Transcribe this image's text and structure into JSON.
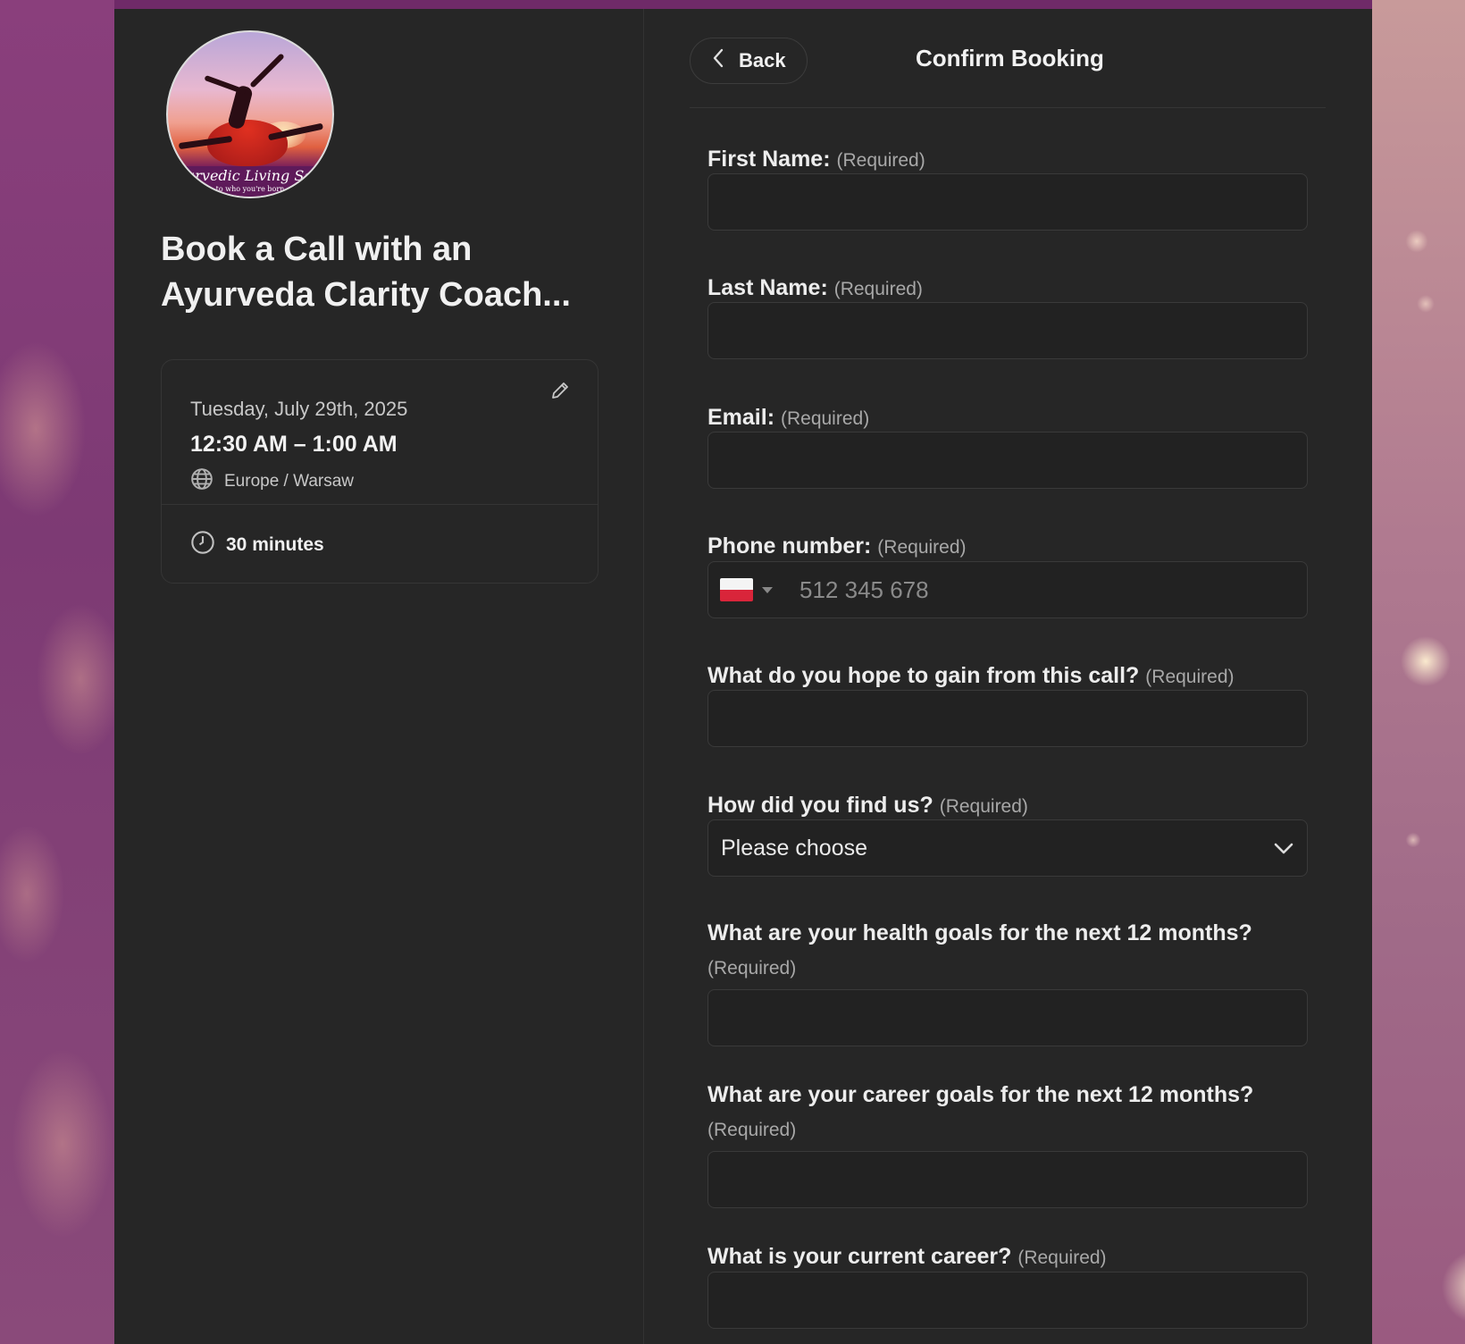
{
  "event": {
    "title": "Book a Call with an Ayurveda Clarity Coach...",
    "avatar_banner": "Ayurvedic Living School",
    "avatar_tagline": "to who you're born",
    "date": "Tuesday, July 29th, 2025",
    "time": "12:30 AM – 1:00 AM",
    "timezone": "Europe / Warsaw",
    "duration": "30 minutes"
  },
  "header": {
    "back_label": "Back",
    "title": "Confirm Booking"
  },
  "form": {
    "required_tag": "(Required)",
    "first_name_label": "First Name:",
    "first_name_value": "",
    "last_name_label": "Last Name:",
    "last_name_value": "",
    "email_label": "Email:",
    "email_value": "",
    "phone_label": "Phone number:",
    "phone_placeholder": "512 345 678",
    "phone_country": "PL",
    "gain_label": "What do you hope to gain from this call?",
    "gain_value": "",
    "find_label": "How did you find us?",
    "find_selected": "Please choose",
    "health_label": "What are your health goals for the next 12 months?",
    "health_value": "",
    "career_goals_label": "What are your career goals for the next 12 months?",
    "career_goals_value": "",
    "current_career_label": "What is your current career?",
    "current_career_value": ""
  },
  "colors": {
    "card_bg": "#262626",
    "accent_bar": "#6f2a68",
    "input_bg": "#222222"
  },
  "icons": {
    "edit": "pencil-icon",
    "timezone": "globe-icon",
    "duration": "clock-icon",
    "back": "chevron-left-icon",
    "select": "chevron-down-icon"
  }
}
